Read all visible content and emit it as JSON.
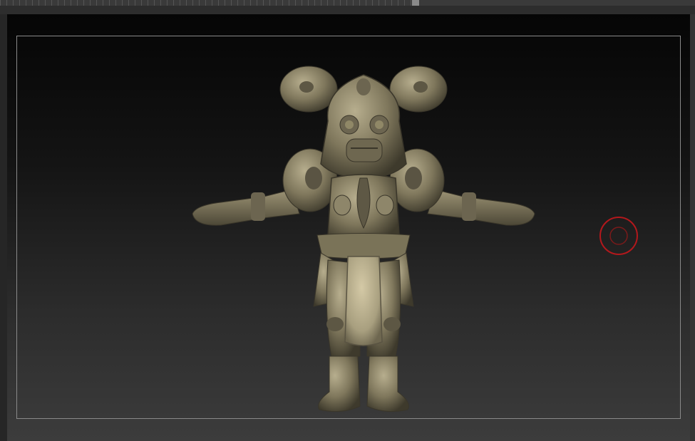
{
  "app": {
    "accent_colors": {
      "model_clay": "#8c8467",
      "brush_ring": "#b3181c",
      "frame": "#8a8a8a"
    }
  },
  "viewport": {
    "model_icon": "sculpted-armored-character",
    "cursor_icon": "brush-circle-icon"
  }
}
